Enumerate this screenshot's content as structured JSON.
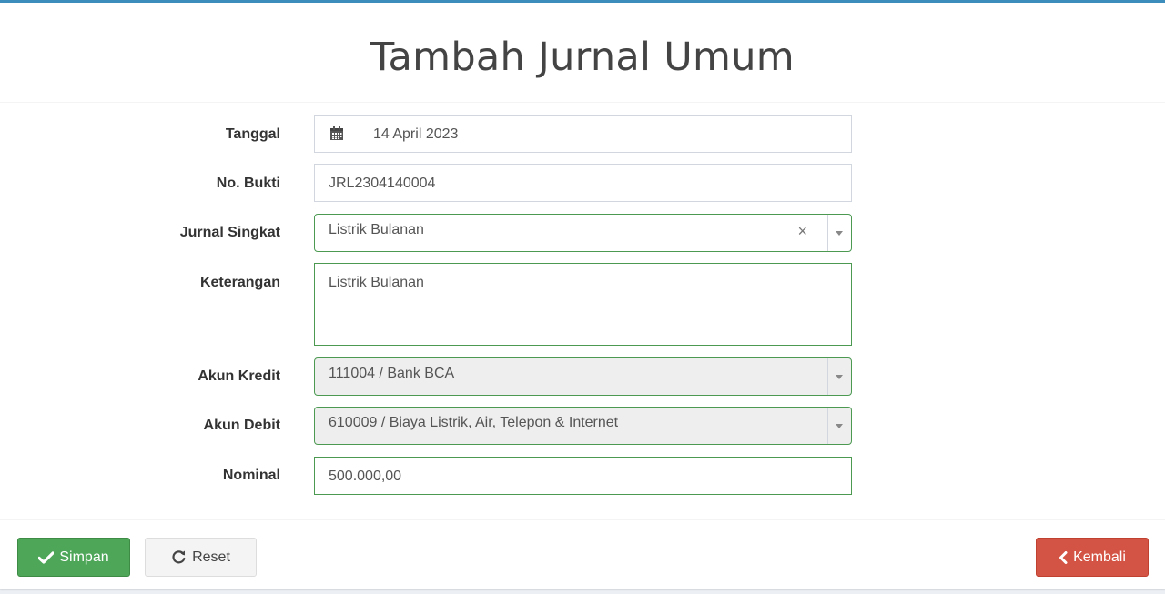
{
  "header": {
    "title": "Tambah Jurnal Umum"
  },
  "form": {
    "tanggal": {
      "label": "Tanggal",
      "value": "14 April 2023"
    },
    "no_bukti": {
      "label": "No. Bukti",
      "value": "JRL2304140004"
    },
    "jurnal_singkat": {
      "label": "Jurnal Singkat",
      "value": "Listrik Bulanan",
      "clear_symbol": "×"
    },
    "keterangan": {
      "label": "Keterangan",
      "value": "Listrik Bulanan"
    },
    "akun_kredit": {
      "label": "Akun Kredit",
      "value": "111004 / Bank BCA"
    },
    "akun_debit": {
      "label": "Akun Debit",
      "value": "610009 / Biaya Listrik, Air, Telepon & Internet"
    },
    "nominal": {
      "label": "Nominal",
      "value": "500.000,00"
    }
  },
  "footer": {
    "save_label": "Simpan",
    "reset_label": "Reset",
    "back_label": "Kembali"
  },
  "icons": {
    "calendar": "calendar-icon",
    "save": "check-icon",
    "reset": "refresh-icon",
    "back": "chevron-left-icon"
  },
  "colors": {
    "accent_top": "#3c8dbc",
    "success": "#4ea659",
    "danger": "#d35445",
    "valid_border": "#4c9a52"
  }
}
